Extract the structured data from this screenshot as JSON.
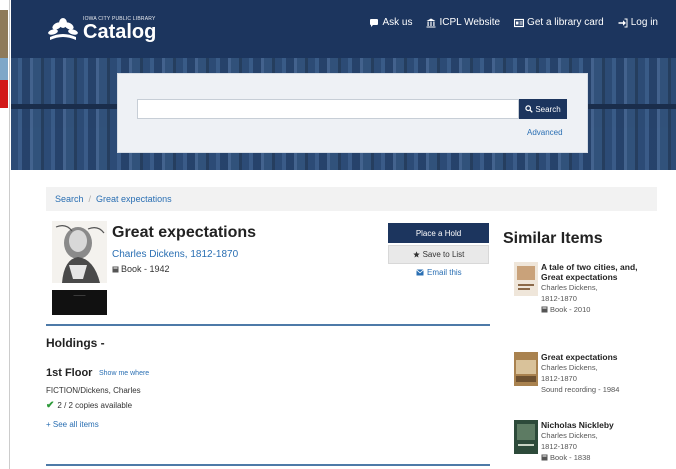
{
  "header": {
    "library_name": "IOWA CITY PUBLIC LIBRARY",
    "app_title": "Catalog",
    "nav": [
      {
        "label": "Ask us",
        "icon": "chat-icon"
      },
      {
        "label": "ICPL Website",
        "icon": "building-icon"
      },
      {
        "label": "Get a library card",
        "icon": "card-icon"
      },
      {
        "label": "Log in",
        "icon": "login-icon"
      }
    ]
  },
  "search": {
    "value": "",
    "placeholder": "",
    "button_label": "Search",
    "advanced_label": "Advanced"
  },
  "breadcrumb": {
    "items": [
      "Search",
      "Great expectations"
    ]
  },
  "record": {
    "title": "Great expectations",
    "author": "Charles Dickens, 1812-1870",
    "format": "Book - 1942",
    "place_hold_label": "Place a Hold",
    "save_to_list_label": "Save to List",
    "email_label": "Email this"
  },
  "holdings": {
    "heading": "Holdings -",
    "location": "1st Floor",
    "show_me_where": "Show me where",
    "call_number": "FICTION/Dickens, Charles",
    "availability": "2 / 2 copies available",
    "see_all": "+ See all items"
  },
  "similar": {
    "heading": "Similar Items",
    "items": [
      {
        "title": "A tale of two cities, and, Great expectations",
        "author_line1": "Charles Dickens,",
        "author_line2": "1812-1870",
        "format": "Book - 2010",
        "thumb_color": "#c9a27a"
      },
      {
        "title": "Great expectations",
        "author_line1": "Charles Dickens,",
        "author_line2": "1812-1870",
        "format": "Sound recording - 1984",
        "thumb_color": "#a9824f"
      },
      {
        "title": "Nicholas Nickleby",
        "author_line1": "Charles Dickens,",
        "author_line2": "1812-1870",
        "format": "Book - 1838",
        "thumb_color": "#2d4a3a"
      }
    ]
  },
  "colors": {
    "header_navy": "#1c355e",
    "link_blue": "#2a6fb3",
    "available_green": "#2e9a3a"
  }
}
